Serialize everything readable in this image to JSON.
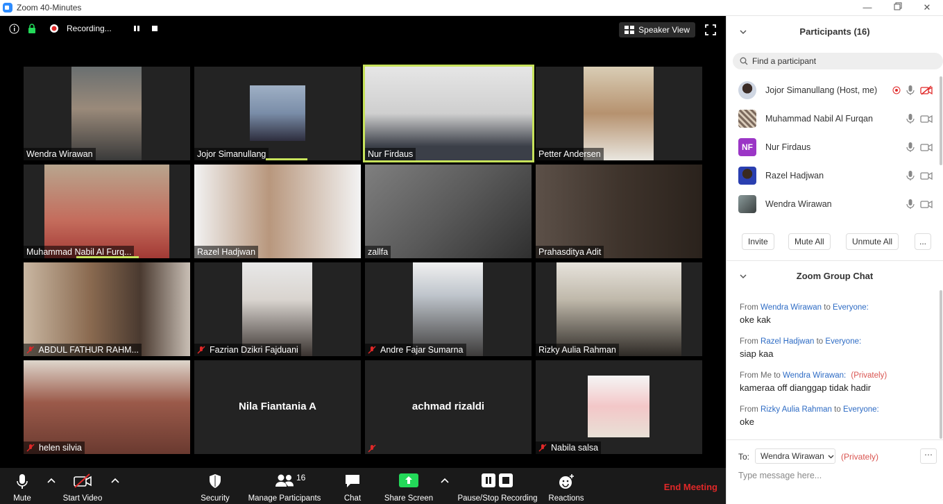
{
  "window": {
    "title": "Zoom 40-Minutes"
  },
  "topbar": {
    "recording_label": "Recording...",
    "speaker_view_label": "Speaker View"
  },
  "tiles": [
    {
      "name": "Wendra Wirawan",
      "muted": false
    },
    {
      "name": "Jojor Simanullang",
      "muted": false
    },
    {
      "name": "Nur Firdaus",
      "muted": false
    },
    {
      "name": "Petter Andersen",
      "muted": false
    },
    {
      "name": "Muhammad Nabil Al Furq...",
      "muted": false
    },
    {
      "name": "Razel Hadjwan",
      "muted": false
    },
    {
      "name": "zallfa",
      "muted": false
    },
    {
      "name": "Prahasditya Adit",
      "muted": false
    },
    {
      "name": "ABDUL FATHUR RAHM...",
      "muted": true
    },
    {
      "name": "Fazrian Dzikri Fajduani",
      "muted": true
    },
    {
      "name": "Andre Fajar Sumarna",
      "muted": true
    },
    {
      "name": "Rizky Aulia Rahman",
      "muted": false
    },
    {
      "name": "helen silvia",
      "muted": true
    },
    {
      "name": "Nila Fiantania A",
      "muted": false
    },
    {
      "name": "achmad rizaldi",
      "muted": true
    },
    {
      "name": "Nabila salsa",
      "muted": true
    }
  ],
  "toolbar": {
    "mute": "Mute",
    "start_video": "Start Video",
    "security": "Security",
    "manage_participants": "Manage Participants",
    "participant_count": "16",
    "chat": "Chat",
    "share_screen": "Share Screen",
    "pause_stop_recording": "Pause/Stop Recording",
    "reactions": "Reactions",
    "end_meeting": "End Meeting"
  },
  "participants_panel": {
    "title": "Participants (16)",
    "search_placeholder": "Find a participant",
    "list": [
      {
        "name": "Jojor Simanullang (Host, me)",
        "avatar_text": ""
      },
      {
        "name": "Muhammad Nabil Al Furqan",
        "avatar_text": ""
      },
      {
        "name": "Nur Firdaus",
        "avatar_text": "NF"
      },
      {
        "name": "Razel Hadjwan",
        "avatar_text": ""
      },
      {
        "name": "Wendra Wirawan",
        "avatar_text": ""
      }
    ],
    "buttons": {
      "invite": "Invite",
      "mute_all": "Mute All",
      "unmute_all": "Unmute All",
      "more": "..."
    }
  },
  "chat_panel": {
    "title": "Zoom Group Chat",
    "messages": [
      {
        "from_prefix": "From",
        "sender": "Wendra Wirawan",
        "to_word": "to",
        "recipient": "Everyone:",
        "privately": "",
        "text": "oke kak"
      },
      {
        "from_prefix": "From",
        "sender": "Razel Hadjwan",
        "to_word": "to",
        "recipient": "Everyone:",
        "privately": "",
        "text": "siap kaa"
      },
      {
        "from_prefix": "From Me",
        "sender": "",
        "to_word": "to",
        "recipient": "Wendra Wirawan:",
        "privately": "(Privately)",
        "text": "kameraa off dianggap tidak hadir"
      },
      {
        "from_prefix": "From",
        "sender": "Rizky Aulia Rahman",
        "to_word": "to",
        "recipient": "Everyone:",
        "privately": "",
        "text": "oke"
      }
    ],
    "to_label": "To:",
    "to_value": "Wendra Wirawan",
    "to_privately": "(Privately)",
    "input_placeholder": "Type message here..."
  }
}
